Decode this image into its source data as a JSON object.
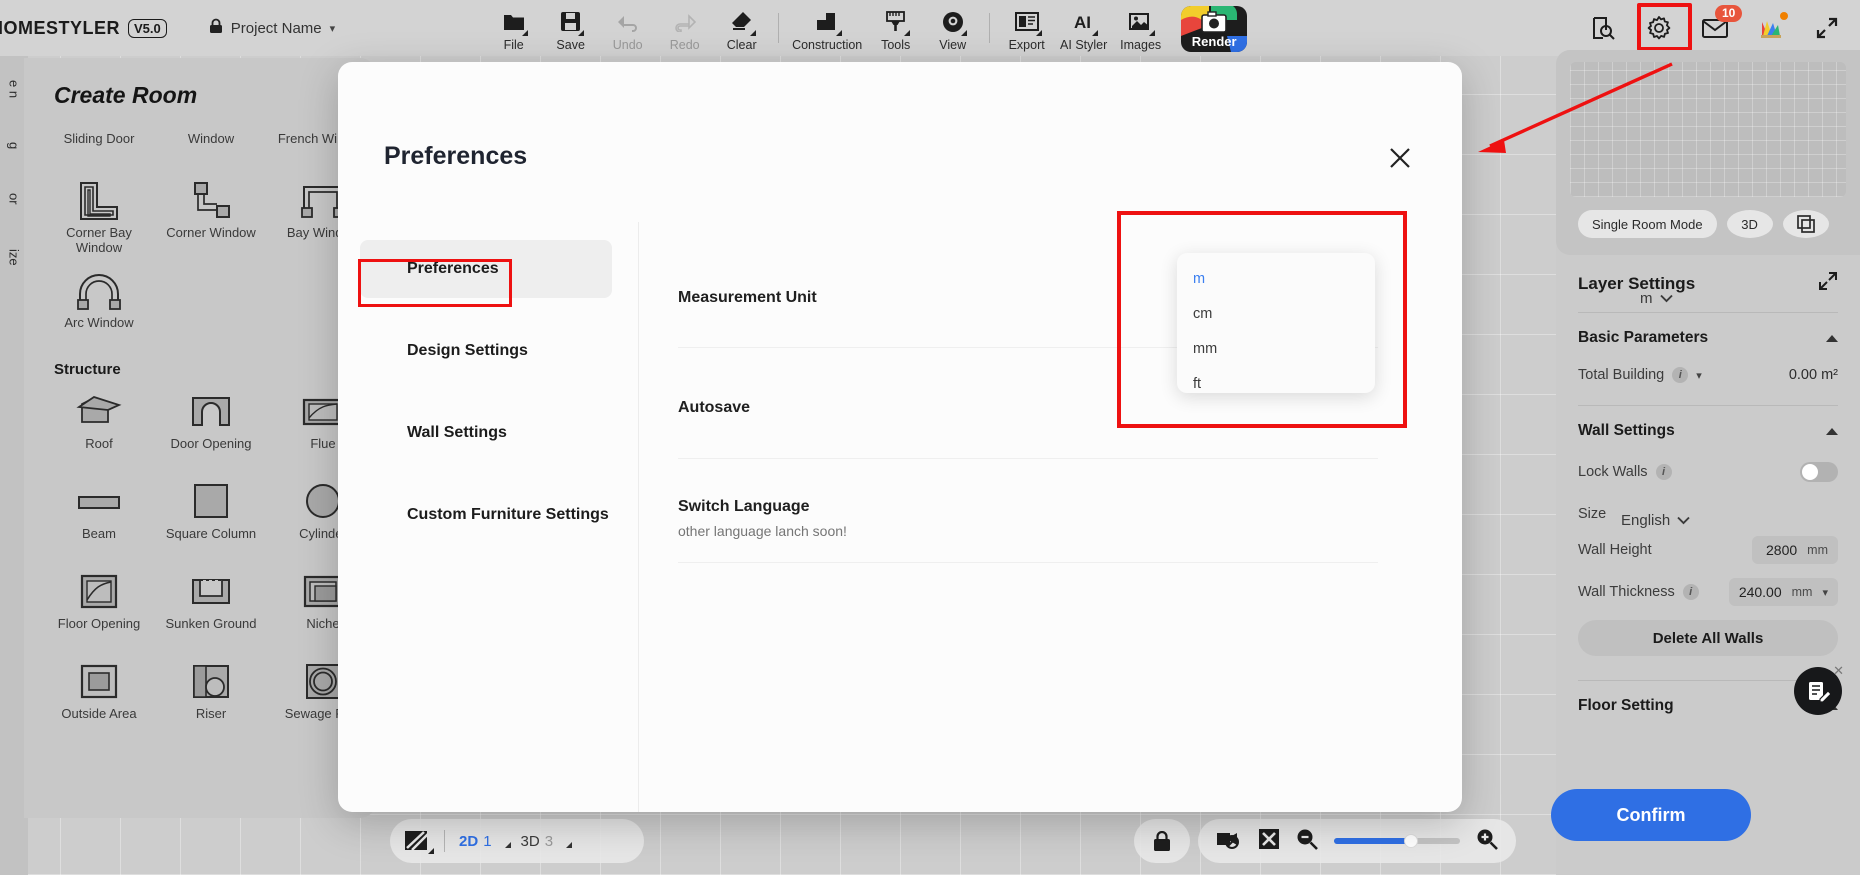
{
  "topbar": {
    "brand": "HOMESTYLER",
    "version": "V5.0",
    "project_name": "Project Name",
    "lock_icon": "lock-icon",
    "caret_icon": "chevron-down-icon",
    "tools": [
      {
        "label": "File",
        "icon": "folder-icon",
        "disabled": false
      },
      {
        "label": "Save",
        "icon": "floppy-disk-icon",
        "disabled": false
      },
      {
        "label": "Undo",
        "icon": "undo-arrow-icon",
        "disabled": true
      },
      {
        "label": "Redo",
        "icon": "redo-arrow-icon",
        "disabled": true
      },
      {
        "label": "Clear",
        "icon": "eraser-icon",
        "disabled": false
      },
      {
        "label": "Construction",
        "icon": "construction-icon",
        "disabled": false
      },
      {
        "label": "Tools",
        "icon": "ruler-brush-icon",
        "disabled": false
      },
      {
        "label": "View",
        "icon": "eye-icon",
        "disabled": false
      },
      {
        "label": "Export",
        "icon": "export-panel-icon",
        "disabled": false
      },
      {
        "label": "AI Styler",
        "icon": "ai-icon",
        "disabled": false
      },
      {
        "label": "Images",
        "icon": "images-icon",
        "disabled": false
      }
    ],
    "render_label": "Render",
    "right_icons": [
      {
        "name": "document-search-icon",
        "label": ""
      },
      {
        "name": "gear-icon",
        "label": ""
      },
      {
        "name": "mail-icon",
        "label": "",
        "badge": "10"
      },
      {
        "name": "color-palette-icon",
        "label": ""
      },
      {
        "name": "expand-fullscreen-icon",
        "label": ""
      }
    ],
    "accent_highlight": "#ee1111"
  },
  "left_rail": {
    "items": [
      "e n",
      "g",
      "or",
      "ize"
    ]
  },
  "left_panel": {
    "title": "Create Room",
    "top_row": [
      {
        "label": "Sliding Door",
        "icon": "sliding-door-icon"
      },
      {
        "label": "Window",
        "icon": "window-icon"
      },
      {
        "label": "French Window",
        "icon": "french-window-icon"
      }
    ],
    "window_items": [
      {
        "label": "Corner Bay Window",
        "icon": "corner-bay-window-icon"
      },
      {
        "label": "Corner Window",
        "icon": "corner-window-icon"
      },
      {
        "label": "Bay Window",
        "icon": "bay-window-icon"
      },
      {
        "label": "Arc Window",
        "icon": "arc-window-icon"
      }
    ],
    "structure_title": "Structure",
    "structure_items": [
      {
        "label": "Roof",
        "icon": "roof-icon"
      },
      {
        "label": "Door Opening",
        "icon": "door-opening-icon"
      },
      {
        "label": "Flue",
        "icon": "flue-icon"
      },
      {
        "label": "Beam",
        "icon": "beam-icon"
      },
      {
        "label": "Square Column",
        "icon": "square-column-icon"
      },
      {
        "label": "Cylinder",
        "icon": "cylinder-icon"
      },
      {
        "label": "Floor Opening",
        "icon": "floor-opening-icon"
      },
      {
        "label": "Sunken Ground",
        "icon": "sunken-ground-icon"
      },
      {
        "label": "Niche",
        "icon": "niche-icon"
      },
      {
        "label": "Outside Area",
        "icon": "outside-area-icon"
      },
      {
        "label": "Riser",
        "icon": "riser-icon"
      },
      {
        "label": "Sewage Pipe",
        "icon": "sewage-pipe-icon"
      }
    ]
  },
  "right_panel": {
    "mini": {
      "mode_label": "Single Room Mode",
      "view_label": "3D",
      "copy_icon": "duplicate-icon"
    },
    "layer_settings_title": "Layer Settings",
    "expand_icon": "expand-diagonal-icon",
    "basic_parameters_title": "Basic Parameters",
    "total_building_label": "Total Building",
    "total_building_value": "0.00 m²",
    "wall_settings_title": "Wall Settings",
    "lock_walls_label": "Lock Walls",
    "lock_walls_on": false,
    "size_label": "Size",
    "wall_height_label": "Wall Height",
    "wall_height_value": "2800",
    "wall_height_unit": "mm",
    "wall_thickness_label": "Wall Thickness",
    "wall_thickness_value": "240.00",
    "wall_thickness_unit": "mm",
    "delete_all_walls_label": "Delete All Walls",
    "floor_setting_title": "Floor Setting",
    "feedback_icon": "feedback-note-icon"
  },
  "bottom_bar": {
    "texture_icon": "hatch-texture-icon",
    "mode_2d": {
      "label": "2D",
      "count": "1"
    },
    "mode_3d": {
      "label": "3D",
      "count": "3"
    },
    "lock_icon": "lock-closed-icon",
    "camera_off_icon": "camera-off-icon",
    "hide_icon": "x-box-icon",
    "zoom_out_icon": "zoom-out-icon",
    "zoom_in_icon": "zoom-in-icon",
    "zoom_percent": 62
  },
  "modal": {
    "title": "Preferences",
    "close_icon": "close-icon",
    "nav": [
      {
        "label": "Preferences",
        "active": true
      },
      {
        "label": "Design Settings",
        "active": false
      },
      {
        "label": "Wall Settings",
        "active": false
      },
      {
        "label": "Custom Furniture Settings",
        "active": false
      }
    ],
    "fields": [
      {
        "label": "Measurement Unit",
        "sub": "",
        "value": "m"
      },
      {
        "label": "Autosave",
        "sub": "",
        "value": ""
      },
      {
        "label": "Switch Language",
        "sub": "other language lanch soon!",
        "value": "English"
      }
    ],
    "unit_dropdown": {
      "options": [
        "m",
        "cm",
        "mm",
        "ft"
      ],
      "selected": "m",
      "selected_color": "#3b7ff0"
    },
    "confirm_label": "Confirm",
    "accent_button": "#2f6fe4"
  }
}
